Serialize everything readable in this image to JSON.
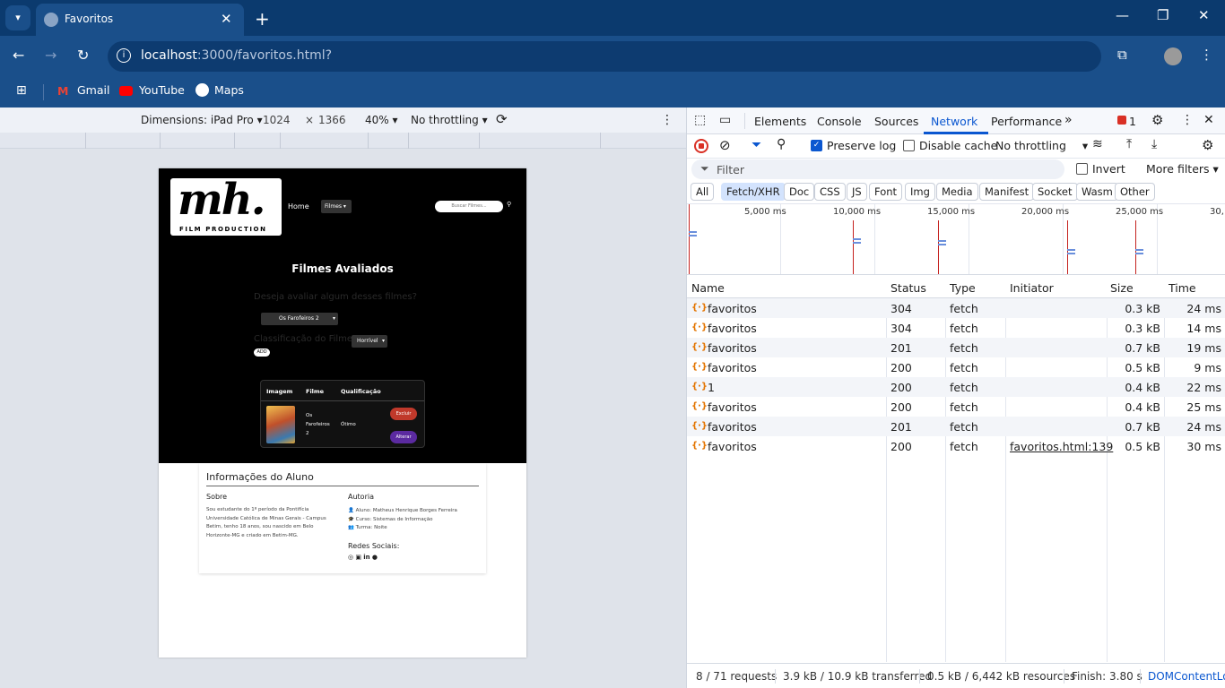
{
  "browser": {
    "tab_title": "Favoritos",
    "url_host": "localhost",
    "url_path": ":3000/favoritos.html?",
    "bookmarks": [
      "Gmail",
      "YouTube",
      "Maps"
    ]
  },
  "device_toolbar": {
    "dimensions_label": "Dimensions: iPad Pro",
    "width": "1024",
    "times": "×",
    "height": "1366",
    "zoom": "40%",
    "throttle": "No throttling"
  },
  "site": {
    "logo_text": "mh.",
    "logo_sub": "FILM PRODUCTION",
    "nav_home": "Home",
    "nav_filmes": "Filmes",
    "search_placeholder": "Buscar Filmes...",
    "section_title": "Filmes Avaliados",
    "question": "Deseja avaliar algum desses filmes?",
    "select_film": "Os Farofeiros 2",
    "rating_label": "Classificação do Filme",
    "select_rating": "Horrível",
    "add_label": "ADD",
    "table_headers": [
      "Imagem",
      "Filme",
      "Qualificação"
    ],
    "row_film": [
      "Os",
      "Farofeiros",
      "2"
    ],
    "row_rating": "Ótimo",
    "delete_label": "Excluir",
    "edit_label": "Alterar",
    "info_title": "Informações do Aluno",
    "about_title": "Sobre",
    "about_text": [
      "Sou estudante do 1º período da Pontifícia",
      "Universidade Católica de Minas Gerais - Campus",
      "Betim, tenho 18 anos, sou nascido em Belo",
      "Horizonte-MG e criado em Betim-MG."
    ],
    "authorship_title": "Autoria",
    "author": "Aluno: Matheus Henrique Borges Ferreira",
    "course": "Curso: Sistemas de Informação",
    "class": "Turma: Noite",
    "social_title": "Redes Sociais:"
  },
  "devtools": {
    "tabs": [
      "Elements",
      "Console",
      "Sources",
      "Network",
      "Performance"
    ],
    "active_tab": "Network",
    "error_count": "1",
    "preserve_log": "Preserve log",
    "disable_cache": "Disable cache",
    "throttle": "No throttling",
    "filter_placeholder": "Filter",
    "invert": "Invert",
    "more_filters": "More filters",
    "chips": [
      "All",
      "Fetch/XHR",
      "Doc",
      "CSS",
      "JS",
      "Font",
      "Img",
      "Media",
      "Manifest",
      "Socket",
      "Wasm",
      "Other"
    ],
    "timeline_ticks": [
      "5,000 ms",
      "10,000 ms",
      "15,000 ms",
      "20,000 ms",
      "25,000 ms",
      "30,"
    ],
    "columns": [
      "Name",
      "Status",
      "Type",
      "Initiator",
      "Size",
      "Time"
    ],
    "rows": [
      {
        "name": "favoritos",
        "status": "304",
        "type": "fetch",
        "initiator": "",
        "size": "0.3 kB",
        "time": "24 ms"
      },
      {
        "name": "favoritos",
        "status": "304",
        "type": "fetch",
        "initiator": "",
        "size": "0.3 kB",
        "time": "14 ms"
      },
      {
        "name": "favoritos",
        "status": "201",
        "type": "fetch",
        "initiator": "",
        "size": "0.7 kB",
        "time": "19 ms"
      },
      {
        "name": "favoritos",
        "status": "200",
        "type": "fetch",
        "initiator": "",
        "size": "0.5 kB",
        "time": "9 ms"
      },
      {
        "name": "1",
        "status": "200",
        "type": "fetch",
        "initiator": "",
        "size": "0.4 kB",
        "time": "22 ms"
      },
      {
        "name": "favoritos",
        "status": "200",
        "type": "fetch",
        "initiator": "",
        "size": "0.4 kB",
        "time": "25 ms"
      },
      {
        "name": "favoritos",
        "status": "201",
        "type": "fetch",
        "initiator": "",
        "size": "0.7 kB",
        "time": "24 ms"
      },
      {
        "name": "favoritos",
        "status": "200",
        "type": "fetch",
        "initiator": "favoritos.html:139",
        "size": "0.5 kB",
        "time": "30 ms"
      }
    ],
    "status_bar": [
      "8 / 71 requests",
      "3.9 kB / 10.9 kB transferred",
      "0.5 kB / 6,442 kB resources",
      "Finish: 3.80 s",
      "DOMContentLoa"
    ]
  }
}
